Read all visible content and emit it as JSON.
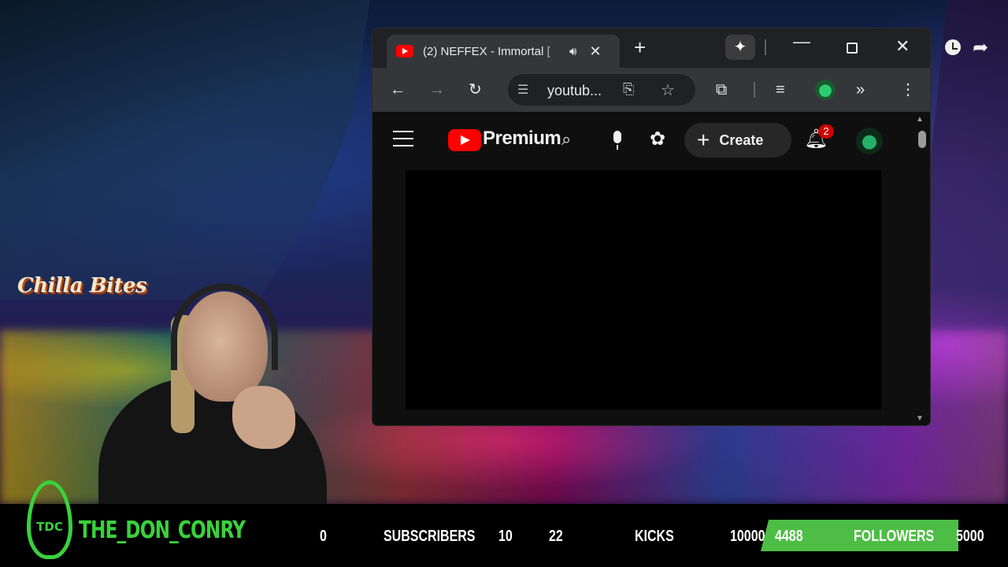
{
  "browser": {
    "tab": {
      "title": "(2) NEFFEX - Immortal [",
      "audio_icon": "volume-icon",
      "close_icon": "close-icon"
    },
    "new_tab_icon": "plus-icon",
    "gemini_icon": "sparkle-icon",
    "window_controls": [
      "minimize",
      "maximize",
      "close"
    ],
    "toolbar": {
      "back_icon": "arrow-left-icon",
      "forward_icon": "arrow-right-icon",
      "reload_icon": "reload-icon",
      "url": "youtub...",
      "site_info_icon": "tune-icon",
      "install_icon": "install-app-icon",
      "bookmark_icon": "star-icon",
      "extensions_icon": "puzzle-icon",
      "media_icon": "playlist-icon",
      "more_tools_icon": "chevron-double-right-icon",
      "menu_icon": "kebab-icon"
    }
  },
  "youtube": {
    "logo_text": "Premium",
    "create_label": "Create",
    "notification_count": "2",
    "colors": {
      "accent": "#ff0000",
      "badge": "#cc0000",
      "background": "#0f0f0f"
    }
  },
  "overlay": {
    "logo_text": "Chilla Bites",
    "channel_name": "THE_DON_CONRY",
    "tdc_text": "TDC",
    "stats": {
      "subscribers_count": "0",
      "subscribers_label": "SUBSCRIBERS",
      "subscribers_goal": "10",
      "kicks_count": "22",
      "kicks_label": "KICKS",
      "kicks_goal": "10000",
      "followers_count": "4488",
      "followers_label": "FOLLOWERS",
      "followers_goal": "5000"
    },
    "followers_progress": 0.8976,
    "colors": {
      "brand_green": "#39d23c",
      "goal_fill": "#4dbd45"
    }
  }
}
